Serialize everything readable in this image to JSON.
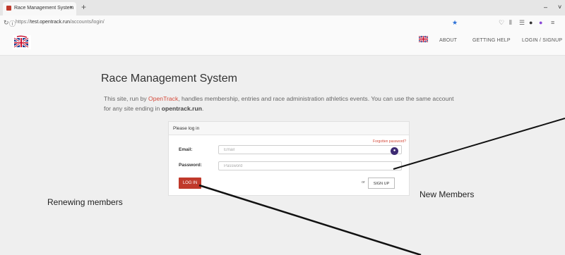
{
  "browser": {
    "tab_title": "Race Management System",
    "tab_close": "×",
    "new_tab": "+",
    "url_prefix": "https://",
    "url_domain": "test.opentrack.run",
    "url_path": "/accounts/login/",
    "window_controls": [
      "–",
      "˅"
    ]
  },
  "navbar": {
    "items": [
      "ABOUT",
      "GETTING HELP",
      "LOGIN / SIGNUP"
    ]
  },
  "page": {
    "title": "Race Management System",
    "intro": {
      "part1": "This site, run by ",
      "link": "OpenTrack",
      "part2": ", handles membership, entries and race administration athletics events. You can use the same account for any site ending in ",
      "domain": "opentrack.run",
      "part3": "."
    }
  },
  "login": {
    "heading": "Please log in",
    "forgot_link": "Forgotten password?",
    "email_label": "Email:",
    "email_placeholder": "Email",
    "password_label": "Password:",
    "password_placeholder": "Password",
    "login_button": "LOG IN",
    "or_text": "or",
    "signup_button": "SIGN UP"
  },
  "annotations": {
    "renewing": "Renewing members",
    "new_members": "New Members"
  },
  "colors": {
    "accent_red": "#c0392b",
    "password_manager_icon": "#3d2a72"
  }
}
